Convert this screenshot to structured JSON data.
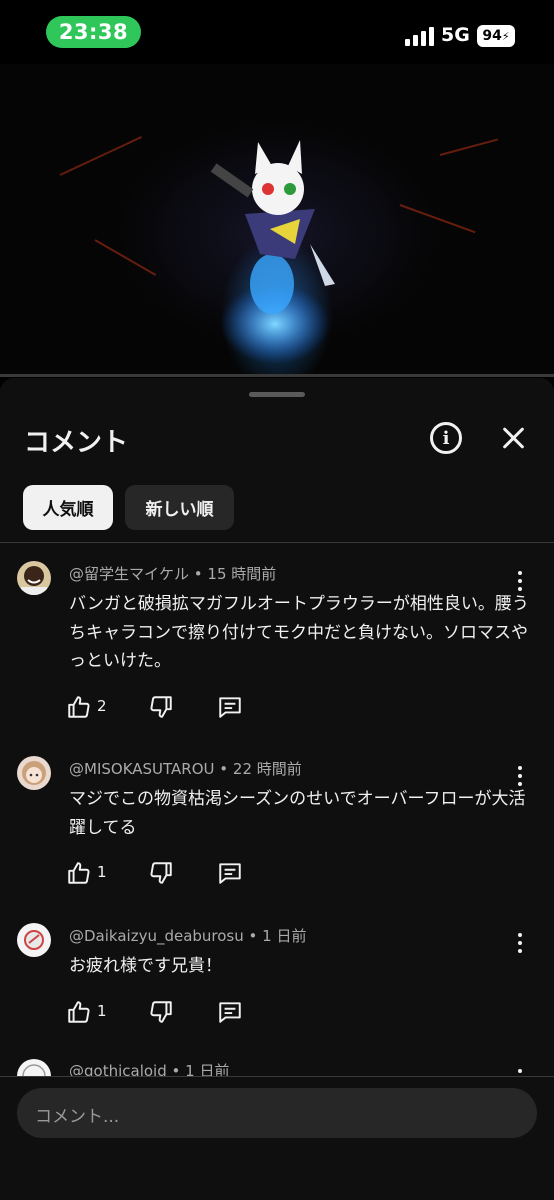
{
  "status_bar": {
    "time": "23:38",
    "network": "5G",
    "battery": "94"
  },
  "video": {
    "playback_progress": 0.0
  },
  "comments_panel": {
    "title": "コメント",
    "sort_chips": [
      "人気順",
      "新しい順"
    ],
    "active_sort": "人気順",
    "comments": [
      {
        "author": "@留学生マイケル",
        "time": "15 時間前",
        "text": "バンガと破損拡マガフルオートプラウラーが相性良い。腰うちキャラコンで擦り付けてモク中だと負けない。ソロマスやっといけた。",
        "likes": "2"
      },
      {
        "author": "@MISOKASUTAROU",
        "time": "22 時間前",
        "text": "マジでこの物資枯渇シーズンのせいでオーバーフローが大活躍してる",
        "likes": "1"
      },
      {
        "author": "@Daikaizyu_deaburosu",
        "time": "1 日前",
        "text": "お疲れ様です兄貴！",
        "likes": "1"
      },
      {
        "author": "@gothicaloid",
        "time": "1 日前",
        "text": "",
        "likes": ""
      }
    ],
    "input_placeholder": "コメント..."
  }
}
